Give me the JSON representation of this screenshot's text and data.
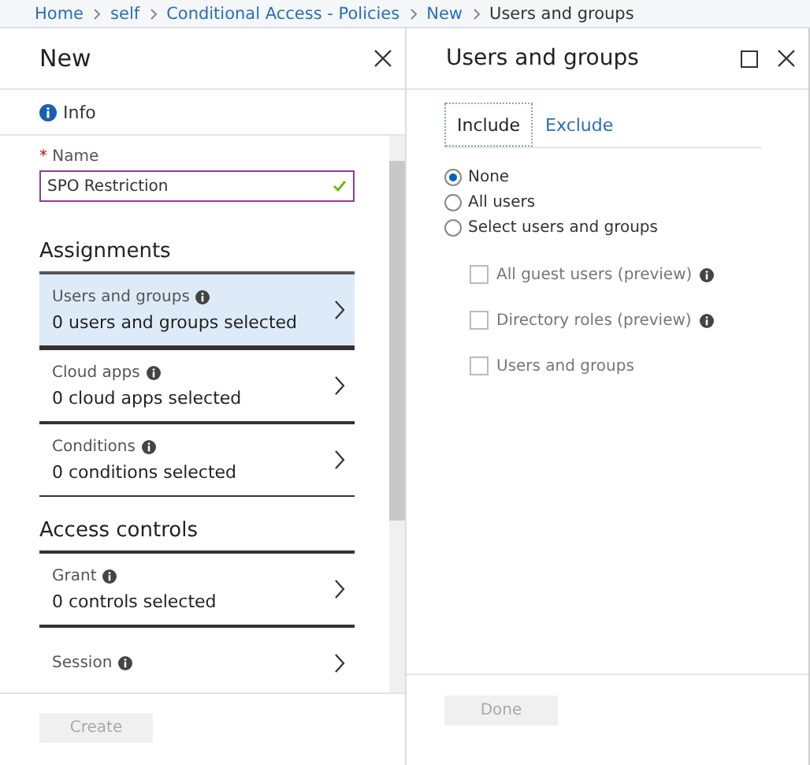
{
  "breadcrumb": [
    {
      "label": "Home",
      "kind": "link"
    },
    {
      "label": "self",
      "kind": "link"
    },
    {
      "label": "Conditional Access - Policies",
      "kind": "link"
    },
    {
      "label": "New",
      "kind": "link"
    },
    {
      "label": "Users and groups",
      "kind": "current"
    }
  ],
  "new_blade": {
    "title": "New",
    "info": "Info",
    "name_field": {
      "label": "Name",
      "required_mark": "*",
      "value": "SPO Restriction",
      "valid": true
    },
    "sections": [
      {
        "heading": "Assignments",
        "items": [
          {
            "title": "Users and groups",
            "summary": "0 users and groups selected",
            "selected": true
          },
          {
            "title": "Cloud apps",
            "summary": "0 cloud apps selected",
            "selected": false
          },
          {
            "title": "Conditions",
            "summary": "0 conditions selected",
            "selected": false
          }
        ]
      },
      {
        "heading": "Access controls",
        "items": [
          {
            "title": "Grant",
            "summary": "0 controls selected",
            "selected": false
          },
          {
            "title": "Session",
            "selected": false
          }
        ]
      }
    ],
    "create_button": {
      "label": "Create",
      "disabled": true
    }
  },
  "users_blade": {
    "title": "Users and groups",
    "tabs": [
      {
        "label": "Include",
        "selected": true
      },
      {
        "label": "Exclude",
        "selected": false
      }
    ],
    "radios": [
      {
        "label": "None",
        "selected": true
      },
      {
        "label": "All users",
        "selected": false
      },
      {
        "label": "Select users and groups",
        "selected": false
      }
    ],
    "checkboxes": [
      {
        "label": "All guest users (preview)",
        "checked": false,
        "disabled": true,
        "info": true
      },
      {
        "label": "Directory roles (preview)",
        "checked": false,
        "disabled": true,
        "info": true
      },
      {
        "label": "Users and groups",
        "checked": false,
        "disabled": true,
        "info": false
      }
    ],
    "done_button": {
      "label": "Done",
      "disabled": true
    }
  }
}
